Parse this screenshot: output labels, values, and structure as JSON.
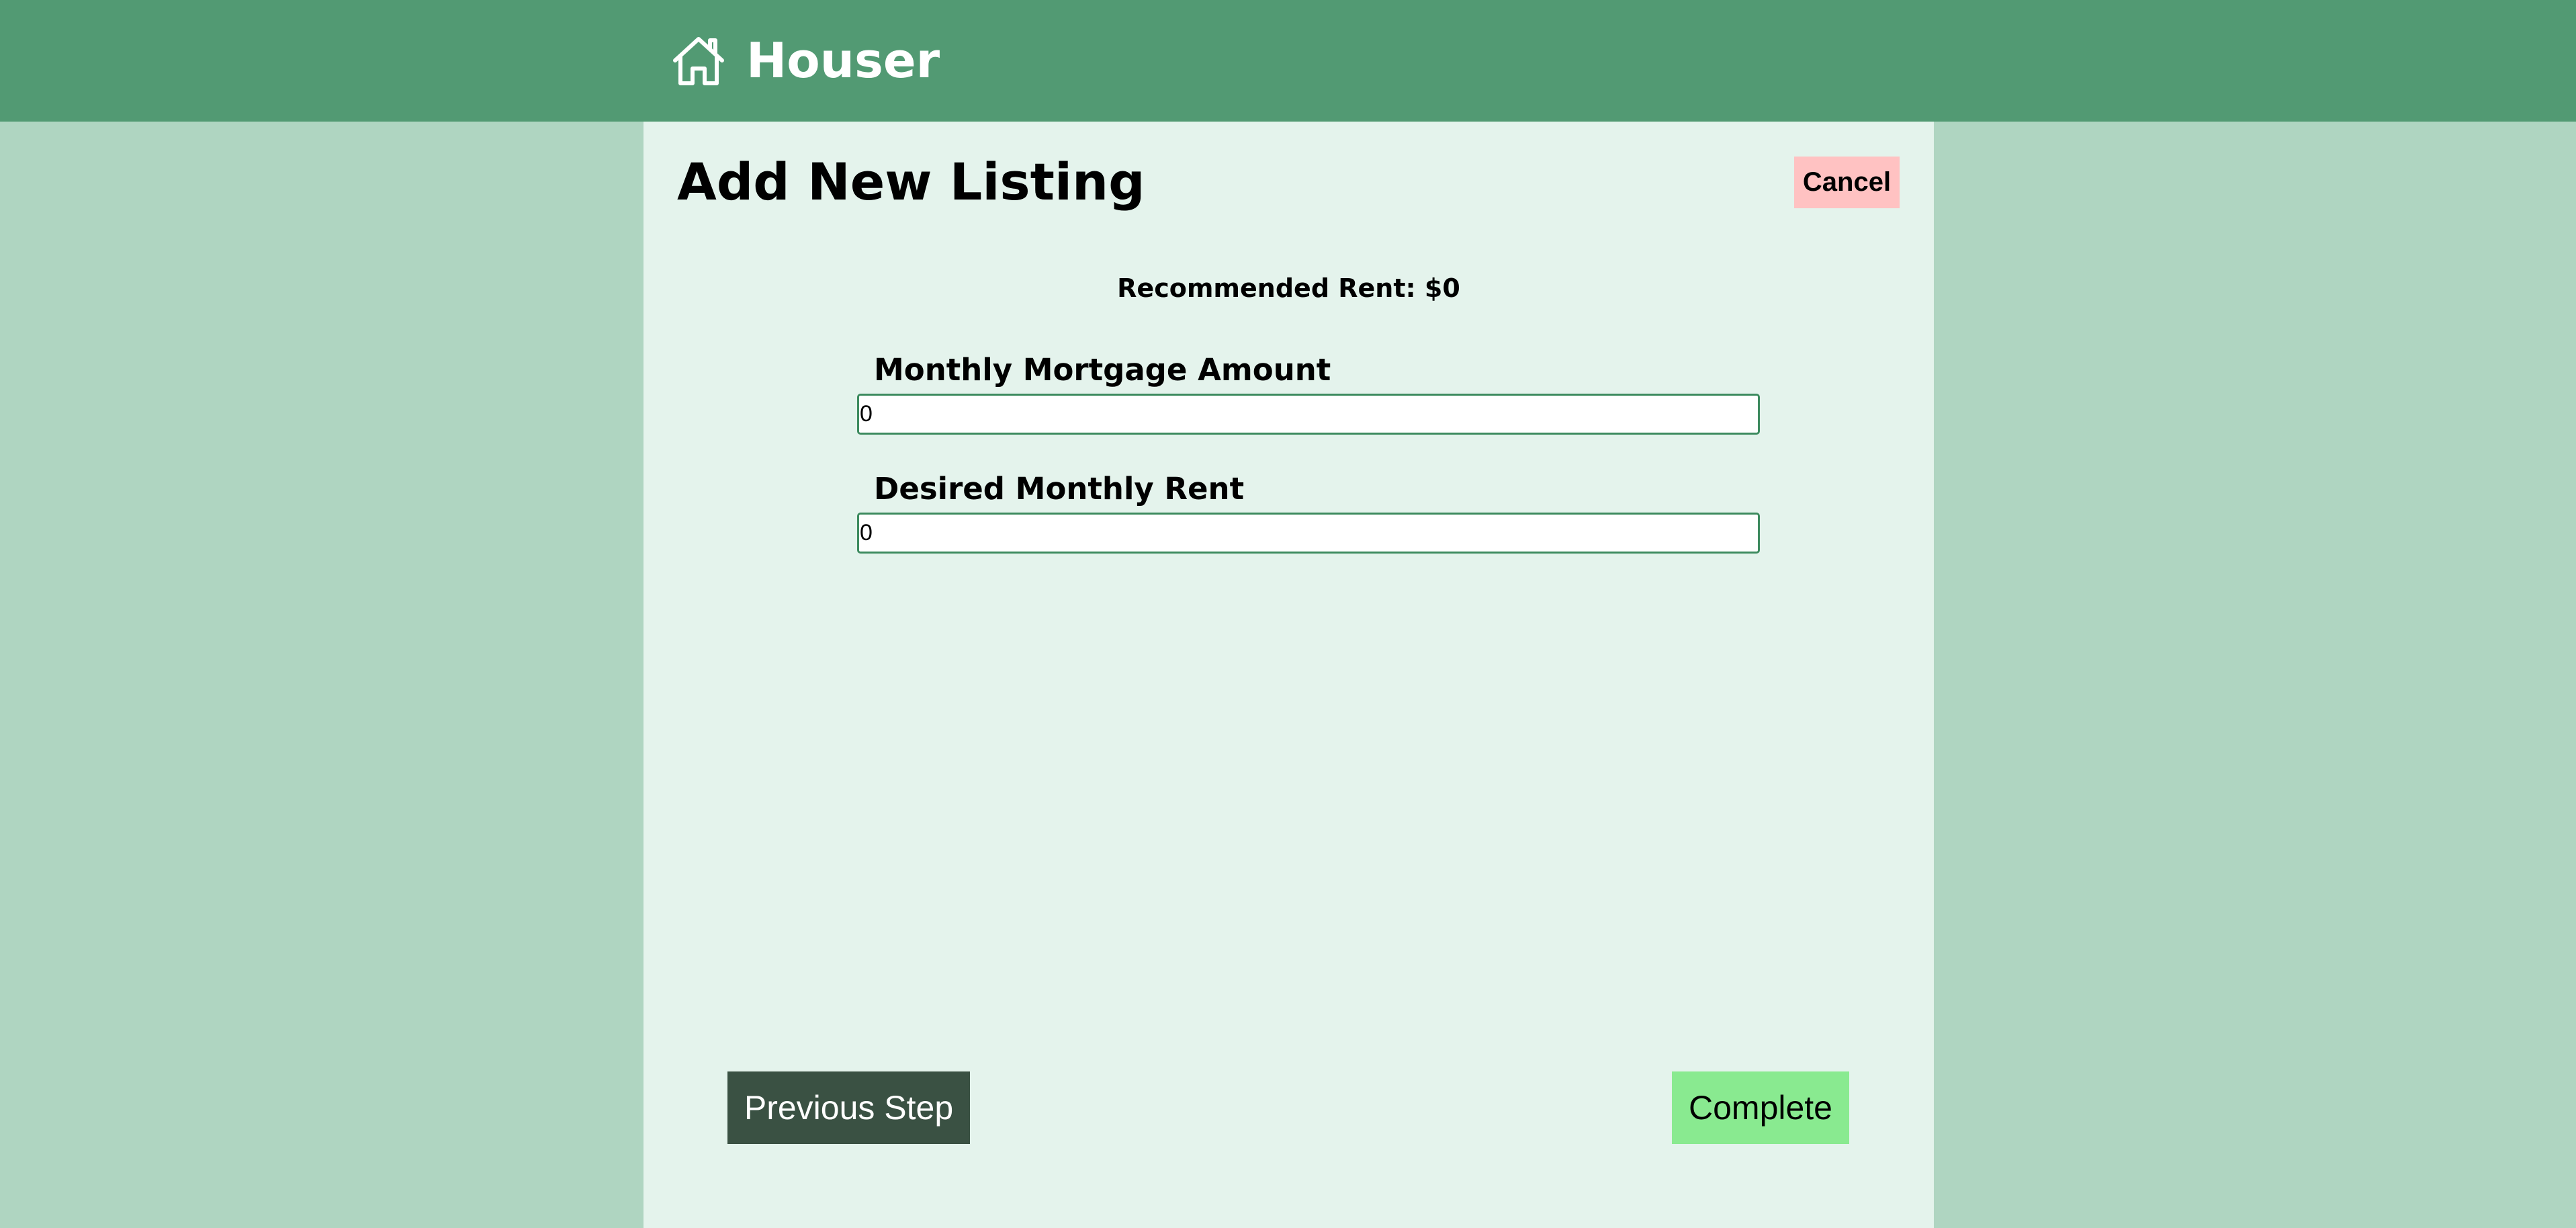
{
  "header": {
    "brand_name": "Houser",
    "brand_icon": "house-icon"
  },
  "form": {
    "title": "Add New Listing",
    "cancel_label": "Cancel",
    "recommended_rent_text": "Recommended Rent: $0",
    "fields": [
      {
        "label": "Monthly Mortgage Amount",
        "value": "0"
      },
      {
        "label": "Desired Monthly Rent",
        "value": "0"
      }
    ],
    "previous_label": "Previous Step",
    "complete_label": "Complete"
  },
  "colors": {
    "page_background": "#afd5c1",
    "header_background": "#529a73",
    "panel_background": "#e4f3ec",
    "cancel_button": "#ffc2c2",
    "previous_button": "#3a5143",
    "complete_button": "#89ea90",
    "input_border": "#3c8a5e"
  }
}
